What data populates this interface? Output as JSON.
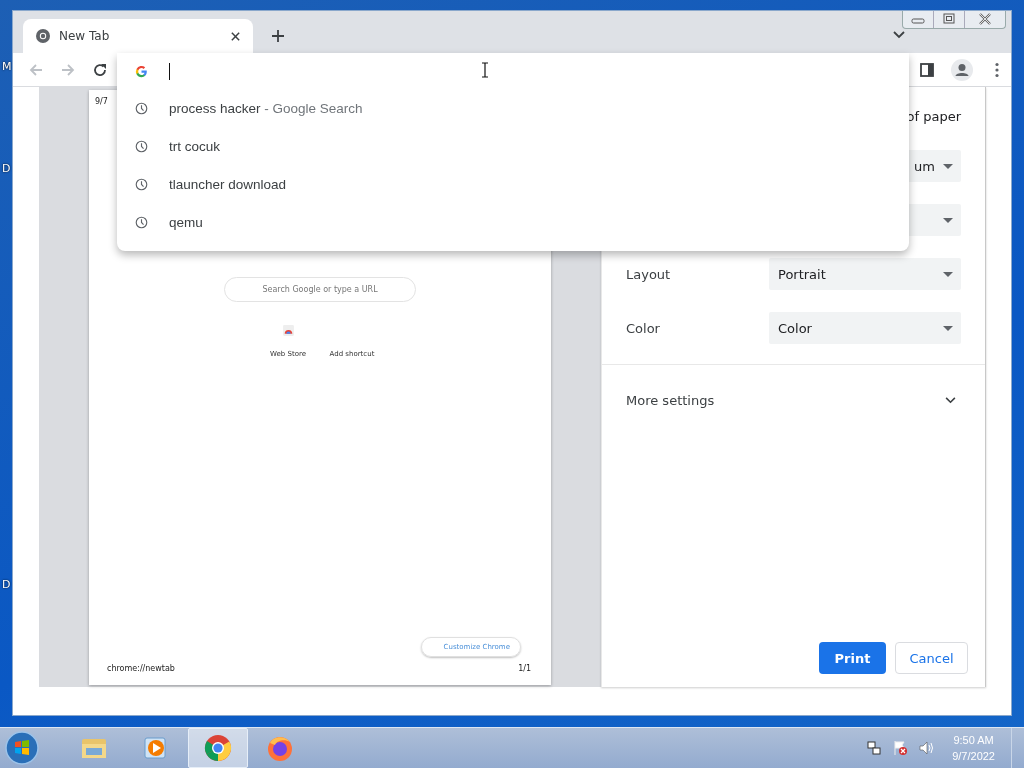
{
  "desktop_labels": [
    "M",
    "D",
    "D"
  ],
  "window": {
    "tab": {
      "title": "New Tab",
      "selected": true
    }
  },
  "omnibox": {
    "suggestions": [
      {
        "text": "process hacker",
        "suffix": " - Google Search"
      },
      {
        "text": "trt cocuk"
      },
      {
        "text": "tlauncher download"
      },
      {
        "text": "qemu"
      }
    ]
  },
  "preview": {
    "date": "9/7",
    "search_placeholder": "Search Google or type a URL",
    "shortcuts": [
      "Web Store",
      "Add shortcut"
    ],
    "customize": "Customize Chrome",
    "footer_url": "chrome://newtab",
    "page_count": "1/1"
  },
  "print_settings": {
    "title": "of paper",
    "selects": [
      {
        "kind": "select",
        "value": "um"
      },
      {
        "kind": "select"
      },
      {
        "kind": "select",
        "label": "Layout",
        "value": "Portrait"
      },
      {
        "kind": "select",
        "label": "Color",
        "value": "Color"
      }
    ],
    "more_settings": {
      "label": "More settings",
      "expanded": false
    },
    "buttons": {
      "print": "Print",
      "cancel": "Cancel"
    }
  },
  "taskbar": {
    "apps": [
      {
        "kind": "explorer",
        "selected": false
      },
      {
        "kind": "media",
        "selected": false
      },
      {
        "kind": "chrome",
        "selected": true
      },
      {
        "kind": "firefox",
        "selected": false
      }
    ],
    "time": "9:50 AM",
    "date": "9/7/2022"
  }
}
